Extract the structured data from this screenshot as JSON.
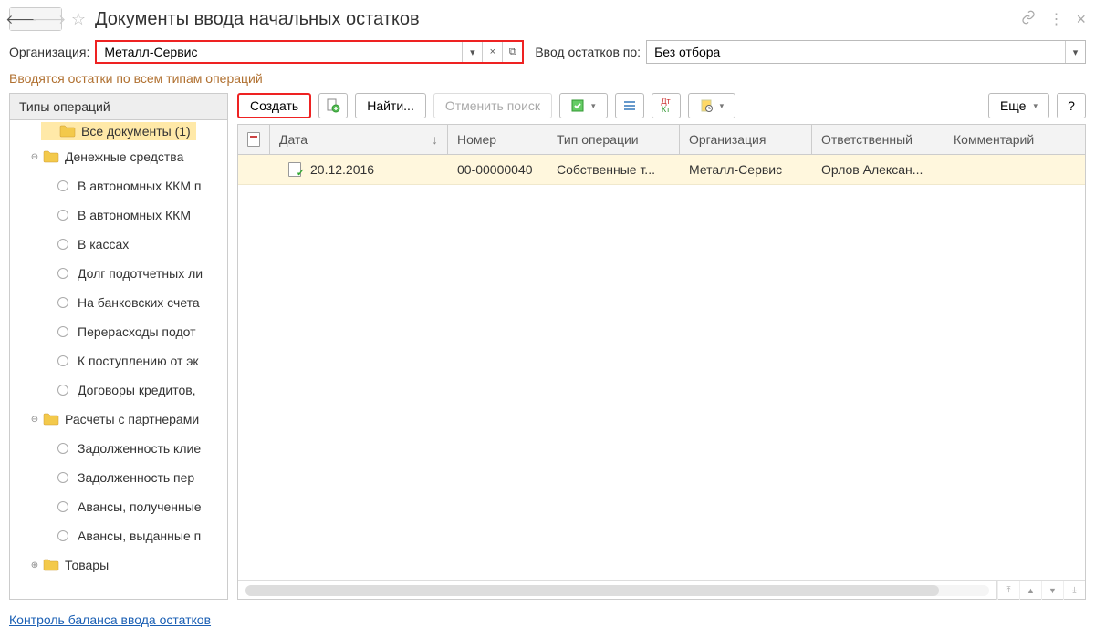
{
  "header": {
    "title": "Документы ввода начальных остатков"
  },
  "filters": {
    "org_label": "Организация:",
    "org_value": "Металл-Сервис",
    "filter_label": "Ввод остатков по:",
    "filter_value": "Без отбора"
  },
  "info_text": "Вводятся остатки по всем типам операций",
  "tree": {
    "header": "Типы операций",
    "items": [
      {
        "type": "folder",
        "label": "Все документы (1)",
        "level": 0,
        "selected": true
      },
      {
        "type": "folder",
        "label": "Денежные средства",
        "level": 1,
        "expanded": true
      },
      {
        "type": "leaf",
        "label": "В автономных ККМ п",
        "level": 2
      },
      {
        "type": "leaf",
        "label": "В автономных ККМ",
        "level": 2
      },
      {
        "type": "leaf",
        "label": "В кассах",
        "level": 2
      },
      {
        "type": "leaf",
        "label": "Долг подотчетных ли",
        "level": 2
      },
      {
        "type": "leaf",
        "label": "На банковских счета",
        "level": 2
      },
      {
        "type": "leaf",
        "label": "Перерасходы подот",
        "level": 2
      },
      {
        "type": "leaf",
        "label": "К поступлению от эк",
        "level": 2
      },
      {
        "type": "leaf",
        "label": "Договоры кредитов,",
        "level": 2
      },
      {
        "type": "folder",
        "label": "Расчеты с партнерами",
        "level": 1,
        "expanded": true
      },
      {
        "type": "leaf",
        "label": "Задолженность клие",
        "level": 2
      },
      {
        "type": "leaf",
        "label": "Задолженность пер",
        "level": 2
      },
      {
        "type": "leaf",
        "label": "Авансы, полученные",
        "level": 2
      },
      {
        "type": "leaf",
        "label": "Авансы, выданные п",
        "level": 2
      },
      {
        "type": "folder",
        "label": "Товары",
        "level": 1,
        "expanded": false
      }
    ]
  },
  "toolbar": {
    "create": "Создать",
    "find": "Найти...",
    "cancel_search": "Отменить поиск",
    "more": "Еще",
    "help": "?"
  },
  "table": {
    "columns": {
      "date": "Дата",
      "number": "Номер",
      "optype": "Тип операции",
      "org": "Организация",
      "resp": "Ответственный",
      "comment": "Комментарий"
    },
    "rows": [
      {
        "date": "20.12.2016",
        "number": "00-00000040",
        "optype": "Собственные т...",
        "org": "Металл-Сервис",
        "resp": "Орлов Алексан...",
        "comment": ""
      }
    ]
  },
  "bottom_link": "Контроль баланса ввода остатков"
}
